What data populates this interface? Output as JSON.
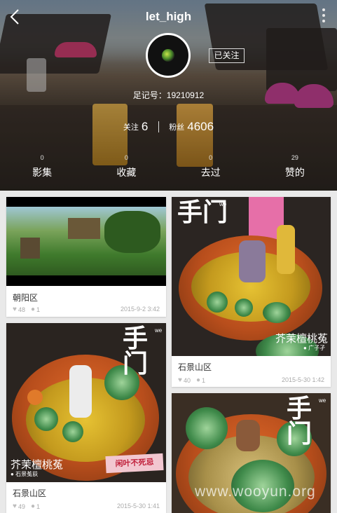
{
  "header": {
    "title": "let_high",
    "follow_button": "已关注",
    "user_id": "足记号：19210912",
    "following_label": "关注",
    "following_count": "6",
    "fans_label": "粉丝",
    "fans_count": "4606"
  },
  "tabs": [
    {
      "count": "0",
      "label": "影集"
    },
    {
      "count": "0",
      "label": "收藏"
    },
    {
      "count": "0",
      "label": "去过"
    },
    {
      "count": "29",
      "label": "赞的"
    }
  ],
  "cards": [
    {
      "place": "朝阳区",
      "likes": "48",
      "comments": "1",
      "time": "2015-9-2 3:42"
    },
    {
      "place": "石景山区",
      "likes": "40",
      "comments": "1",
      "time": "2015-5-30 1:42",
      "overlay_text": "芥茉檀桃菟",
      "overlay_sub": "广子孑"
    },
    {
      "place": "石景山区",
      "likes": "49",
      "comments": "1",
      "time": "2015-5-30 1:41",
      "overlay_text": "芥茉檀桃菟",
      "overlay_sub": "石景菟荻",
      "sign_text": "闲叶不死忌"
    },
    {
      "place": "",
      "likes": "",
      "comments": "",
      "time": ""
    }
  ],
  "logo": {
    "glyph": "手门",
    "we": "we"
  },
  "watermark": "www.wooyun.org",
  "colors": {
    "accent": "#b83d8a",
    "pot": "#c9551f",
    "soil": "#d8b22a"
  }
}
